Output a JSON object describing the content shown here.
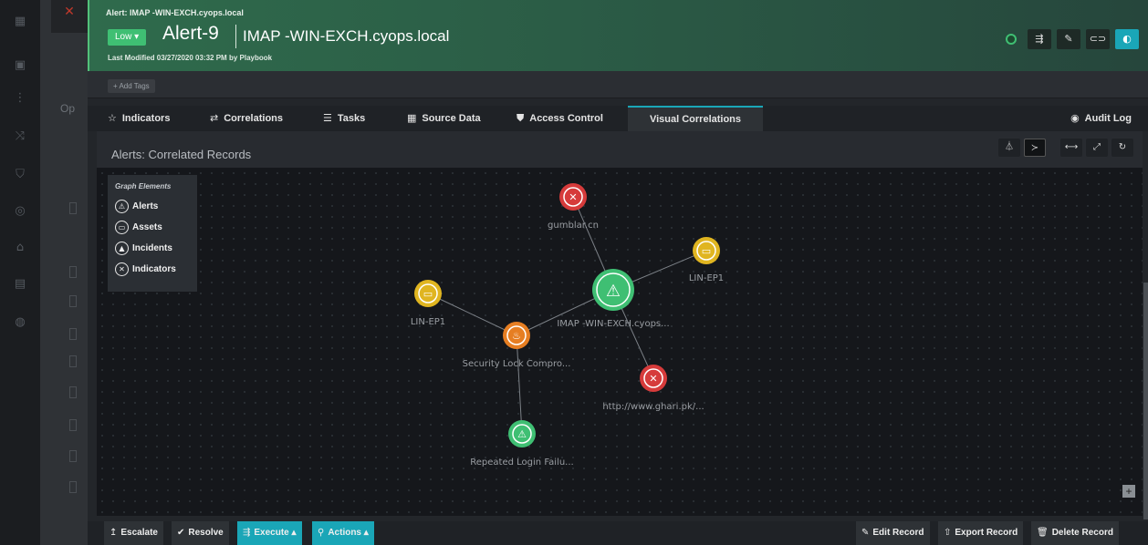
{
  "background": {
    "op_label": "Op",
    "close_icon": "close-x-icon",
    "rail_icons": [
      "grid-icon",
      "dashboard-icon",
      "network-icon",
      "shuffle-icon",
      "shield-icon",
      "compass-icon",
      "bank-icon",
      "chart-icon",
      "globe-icon"
    ]
  },
  "header": {
    "breadcrumb": "Alert: IMAP -WIN-EXCH.cyops.local",
    "severity": "Low",
    "alert_id": "Alert-9",
    "title": "IMAP -WIN-EXCH.cyops.local",
    "modified": "Last Modified 03/27/2020 03:32 PM by Playbook",
    "accent": "#52c27a"
  },
  "tags": {
    "add_label": "+ Add Tags"
  },
  "tabs": [
    {
      "label": "Indicators",
      "icon": "☆"
    },
    {
      "label": "Correlations",
      "icon": "⇄"
    },
    {
      "label": "Tasks",
      "icon": "☰"
    },
    {
      "label": "Source Data",
      "icon": "▦"
    },
    {
      "label": "Access Control",
      "icon": "⛊"
    },
    {
      "label": "Visual Correlations",
      "icon": ""
    },
    {
      "label": "Audit Log",
      "icon": "◉"
    }
  ],
  "panel": {
    "title": "Alerts: Correlated Records"
  },
  "legend": {
    "title": "Graph Elements",
    "items": [
      {
        "label": "Alerts",
        "icon": "⚠"
      },
      {
        "label": "Assets",
        "icon": "▭"
      },
      {
        "label": "Incidents",
        "icon": "▲"
      },
      {
        "label": "Indicators",
        "icon": "✕"
      }
    ]
  },
  "graph": {
    "nodes": [
      {
        "id": "center",
        "label": "IMAP -WIN-EXCH.cyops...",
        "kind": "alert",
        "color": "#3fbf73",
        "big": true
      },
      {
        "id": "gumblar",
        "label": "gumblar.cn",
        "kind": "indicator",
        "color": "#d63b3b"
      },
      {
        "id": "lin1",
        "label": "LIN-EP1",
        "kind": "asset",
        "color": "#e0b520"
      },
      {
        "id": "lin2",
        "label": "LIN-EP1",
        "kind": "asset",
        "color": "#e0b520"
      },
      {
        "id": "incident",
        "label": "Security Lock Compro...",
        "kind": "incident",
        "color": "#e67e22"
      },
      {
        "id": "ghari",
        "label": "http://www.ghari.pk/...",
        "kind": "indicator",
        "color": "#d63b3b"
      },
      {
        "id": "repeated",
        "label": "Repeated Login Failu...",
        "kind": "alert",
        "color": "#3fbf73"
      }
    ],
    "edges": [
      [
        "center",
        "gumblar"
      ],
      [
        "center",
        "lin1"
      ],
      [
        "center",
        "incident"
      ],
      [
        "center",
        "ghari"
      ],
      [
        "incident",
        "lin2"
      ],
      [
        "incident",
        "repeated"
      ]
    ]
  },
  "footer": {
    "escalate": "Escalate",
    "resolve": "Resolve",
    "execute": "Execute",
    "actions": "Actions",
    "edit": "Edit Record",
    "export": "Export Record",
    "delete": "Delete Record"
  }
}
